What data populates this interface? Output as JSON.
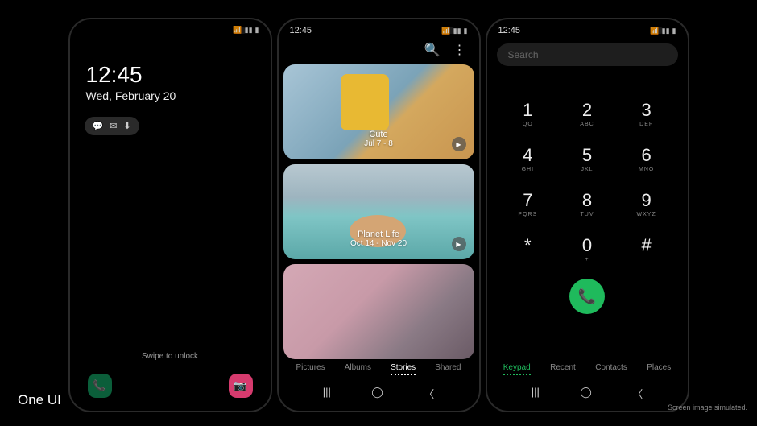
{
  "marketing": {
    "brand": "One UI",
    "disclaimer": "Screen image simulated."
  },
  "status": {
    "time": "12:45"
  },
  "lock_screen": {
    "time": "12:45",
    "date": "Wed, February 20",
    "swipe_hint": "Swipe to unlock"
  },
  "gallery": {
    "stories": [
      {
        "title": "Cute",
        "date": "Jul 7 - 8"
      },
      {
        "title": "Planet Life",
        "date": "Oct 14 - Nov 20"
      },
      {
        "title": "",
        "date": ""
      }
    ],
    "tabs": [
      "Pictures",
      "Albums",
      "Stories",
      "Shared"
    ],
    "active_tab": "Stories"
  },
  "dialer": {
    "search_placeholder": "Search",
    "keys": [
      {
        "num": "1",
        "sub": "QO"
      },
      {
        "num": "2",
        "sub": "ABC"
      },
      {
        "num": "3",
        "sub": "DEF"
      },
      {
        "num": "4",
        "sub": "GHI"
      },
      {
        "num": "5",
        "sub": "JKL"
      },
      {
        "num": "6",
        "sub": "MNO"
      },
      {
        "num": "7",
        "sub": "PQRS"
      },
      {
        "num": "8",
        "sub": "TUV"
      },
      {
        "num": "9",
        "sub": "WXYZ"
      },
      {
        "num": "*",
        "sub": ""
      },
      {
        "num": "0",
        "sub": "+"
      },
      {
        "num": "#",
        "sub": ""
      }
    ],
    "tabs": [
      "Keypad",
      "Recent",
      "Contacts",
      "Places"
    ],
    "active_tab": "Keypad"
  }
}
